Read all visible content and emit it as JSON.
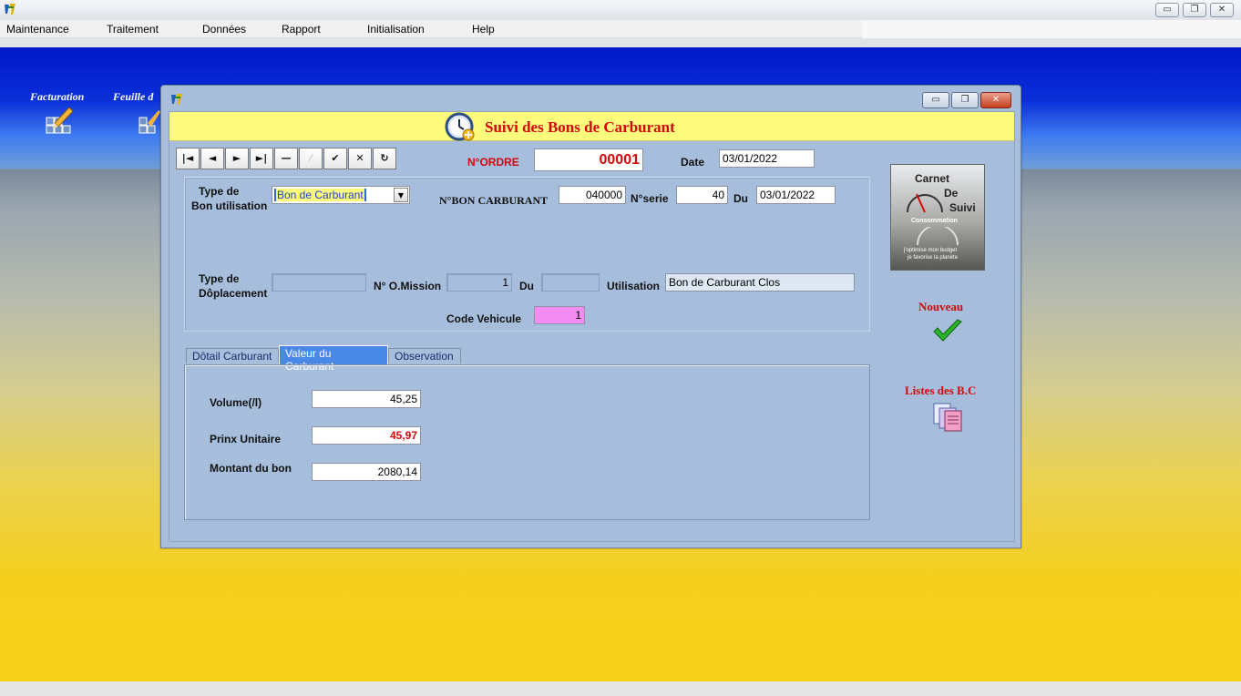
{
  "menu": {
    "items": [
      "Maintenance",
      "Traitement",
      "Données",
      "Rapport",
      "Initialisation",
      "Help"
    ]
  },
  "shortcuts": {
    "facturation": "Facturation",
    "feuille": "Feuille d"
  },
  "window_controls": {
    "minimize": "▭",
    "restore": "❐",
    "close": "✕"
  },
  "dialog": {
    "title": "Suivi des Bons de Carburant",
    "nav": {
      "first": "|◄",
      "prev": "◄",
      "next": "►",
      "last": "►|",
      "delete": "—",
      "edit": "⁄",
      "save": "✔",
      "cancel": "✕",
      "refresh": "↻"
    },
    "n_ordre_label": "N°ORDRE",
    "n_ordre_value": "00001",
    "date_label": "Date",
    "date_value": "03/01/2022",
    "type_bon_label_1": "Type de",
    "type_bon_label_2": "Bon utilisation",
    "type_bon_value": "Bon de Carburant",
    "n_bon_label": "N°BON CARBURANT",
    "n_bon_value": "040000",
    "n_serie_label": "N°serie",
    "n_serie_value": "40",
    "du_label": "Du",
    "du_value": "03/01/2022",
    "type_depl_label_1": "Type de",
    "type_depl_label_2": "Dôplacement",
    "type_depl_value": "",
    "n_mission_label": "N° O.Mission",
    "n_mission_value": "1",
    "du2_label": "Du",
    "du2_value": "",
    "utilisation_label": "Utilisation",
    "utilisation_value": "Bon de Carburant Clos",
    "code_vehicule_label": "Code Vehicule",
    "code_vehicule_value": "1",
    "tabs": [
      "Dôtail Carburant",
      "Valeur du Carburant",
      "Observation"
    ],
    "volume_label": "Volume(/l)",
    "volume_value": "45,25",
    "prix_label": "Prinx Unitaire",
    "prix_value": "45,97",
    "montant_label": "Montant du bon",
    "montant_value": "2080,14",
    "logo": {
      "line1": "Carnet",
      "line2": "De",
      "line3": "Suivi",
      "line4": "Consommation",
      "line5": "j'optimise mon budget",
      "line6": "je favorise la planète"
    },
    "nouveau_label": "Nouveau",
    "listes_label": "Listes des B.C"
  },
  "colors": {
    "title_red": "#d4070c",
    "title_band": "#fdfb7c",
    "dialog_bg": "#a6bddb",
    "active_tab": "#4a88e8",
    "code_vehicule_bg": "#f48cf2"
  }
}
